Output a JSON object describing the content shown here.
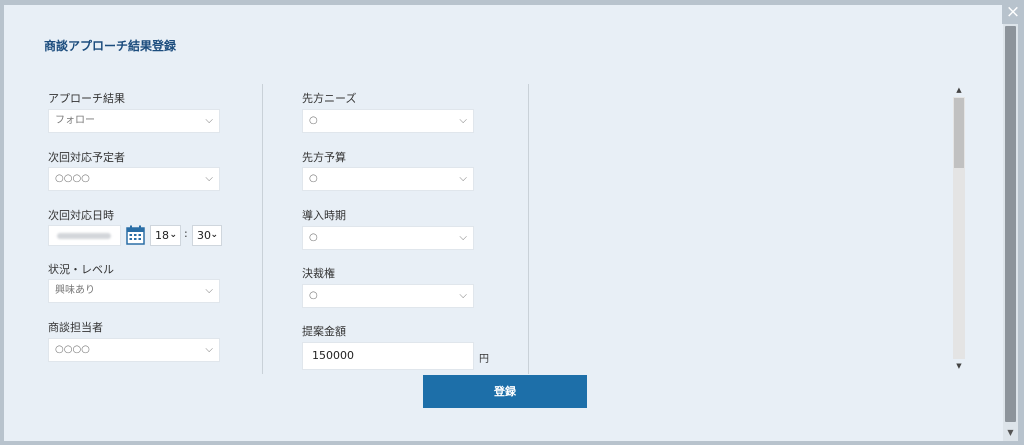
{
  "title": "商談アプローチ結果登録",
  "close_label": "×",
  "left": {
    "approach_result": {
      "label": "アプローチ結果",
      "value": "フォロー"
    },
    "next_assignee": {
      "label": "次回対応予定者",
      "value": "○○○○"
    },
    "next_datetime": {
      "label": "次回対応日時",
      "hour": "18",
      "minute": "30",
      "separator": ":"
    },
    "status_level": {
      "label": "状況・レベル",
      "value": "興味あり"
    },
    "sales_rep": {
      "label": "商談担当者",
      "value": "○○○○"
    }
  },
  "middle": {
    "needs": {
      "label": "先方ニーズ",
      "value": "○"
    },
    "budget": {
      "label": "先方予算",
      "value": "○"
    },
    "timing": {
      "label": "導入時期",
      "value": "○"
    },
    "authority": {
      "label": "決裁権",
      "value": "○"
    },
    "amount": {
      "label": "提案金額",
      "value": "150000",
      "unit": "円"
    }
  },
  "submit_label": "登録",
  "icons": {
    "close": "close-icon",
    "chevron": "chevron-down-icon",
    "calendar": "calendar-icon"
  },
  "colors": {
    "accent": "#1d6fa9",
    "title": "#1b4c7d",
    "background": "#e8eff6"
  }
}
